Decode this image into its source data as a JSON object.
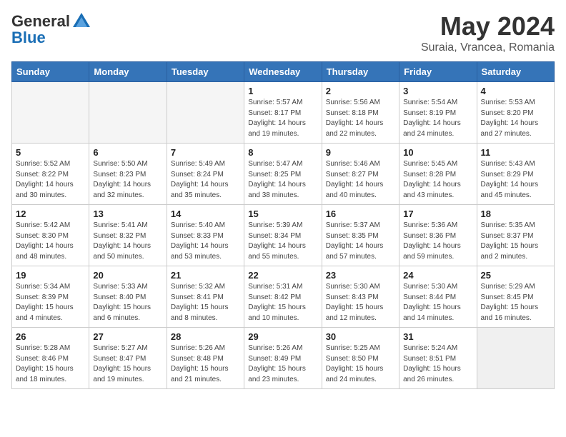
{
  "logo": {
    "general": "General",
    "blue": "Blue"
  },
  "title": "May 2024",
  "subtitle": "Suraia, Vrancea, Romania",
  "days_of_week": [
    "Sunday",
    "Monday",
    "Tuesday",
    "Wednesday",
    "Thursday",
    "Friday",
    "Saturday"
  ],
  "weeks": [
    [
      {
        "day": "",
        "info": "",
        "empty": true
      },
      {
        "day": "",
        "info": "",
        "empty": true
      },
      {
        "day": "",
        "info": "",
        "empty": true
      },
      {
        "day": "1",
        "info": "Sunrise: 5:57 AM\nSunset: 8:17 PM\nDaylight: 14 hours\nand 19 minutes."
      },
      {
        "day": "2",
        "info": "Sunrise: 5:56 AM\nSunset: 8:18 PM\nDaylight: 14 hours\nand 22 minutes."
      },
      {
        "day": "3",
        "info": "Sunrise: 5:54 AM\nSunset: 8:19 PM\nDaylight: 14 hours\nand 24 minutes."
      },
      {
        "day": "4",
        "info": "Sunrise: 5:53 AM\nSunset: 8:20 PM\nDaylight: 14 hours\nand 27 minutes."
      }
    ],
    [
      {
        "day": "5",
        "info": "Sunrise: 5:52 AM\nSunset: 8:22 PM\nDaylight: 14 hours\nand 30 minutes."
      },
      {
        "day": "6",
        "info": "Sunrise: 5:50 AM\nSunset: 8:23 PM\nDaylight: 14 hours\nand 32 minutes."
      },
      {
        "day": "7",
        "info": "Sunrise: 5:49 AM\nSunset: 8:24 PM\nDaylight: 14 hours\nand 35 minutes."
      },
      {
        "day": "8",
        "info": "Sunrise: 5:47 AM\nSunset: 8:25 PM\nDaylight: 14 hours\nand 38 minutes."
      },
      {
        "day": "9",
        "info": "Sunrise: 5:46 AM\nSunset: 8:27 PM\nDaylight: 14 hours\nand 40 minutes."
      },
      {
        "day": "10",
        "info": "Sunrise: 5:45 AM\nSunset: 8:28 PM\nDaylight: 14 hours\nand 43 minutes."
      },
      {
        "day": "11",
        "info": "Sunrise: 5:43 AM\nSunset: 8:29 PM\nDaylight: 14 hours\nand 45 minutes."
      }
    ],
    [
      {
        "day": "12",
        "info": "Sunrise: 5:42 AM\nSunset: 8:30 PM\nDaylight: 14 hours\nand 48 minutes."
      },
      {
        "day": "13",
        "info": "Sunrise: 5:41 AM\nSunset: 8:32 PM\nDaylight: 14 hours\nand 50 minutes."
      },
      {
        "day": "14",
        "info": "Sunrise: 5:40 AM\nSunset: 8:33 PM\nDaylight: 14 hours\nand 53 minutes."
      },
      {
        "day": "15",
        "info": "Sunrise: 5:39 AM\nSunset: 8:34 PM\nDaylight: 14 hours\nand 55 minutes."
      },
      {
        "day": "16",
        "info": "Sunrise: 5:37 AM\nSunset: 8:35 PM\nDaylight: 14 hours\nand 57 minutes."
      },
      {
        "day": "17",
        "info": "Sunrise: 5:36 AM\nSunset: 8:36 PM\nDaylight: 14 hours\nand 59 minutes."
      },
      {
        "day": "18",
        "info": "Sunrise: 5:35 AM\nSunset: 8:37 PM\nDaylight: 15 hours\nand 2 minutes."
      }
    ],
    [
      {
        "day": "19",
        "info": "Sunrise: 5:34 AM\nSunset: 8:39 PM\nDaylight: 15 hours\nand 4 minutes."
      },
      {
        "day": "20",
        "info": "Sunrise: 5:33 AM\nSunset: 8:40 PM\nDaylight: 15 hours\nand 6 minutes."
      },
      {
        "day": "21",
        "info": "Sunrise: 5:32 AM\nSunset: 8:41 PM\nDaylight: 15 hours\nand 8 minutes."
      },
      {
        "day": "22",
        "info": "Sunrise: 5:31 AM\nSunset: 8:42 PM\nDaylight: 15 hours\nand 10 minutes."
      },
      {
        "day": "23",
        "info": "Sunrise: 5:30 AM\nSunset: 8:43 PM\nDaylight: 15 hours\nand 12 minutes."
      },
      {
        "day": "24",
        "info": "Sunrise: 5:30 AM\nSunset: 8:44 PM\nDaylight: 15 hours\nand 14 minutes."
      },
      {
        "day": "25",
        "info": "Sunrise: 5:29 AM\nSunset: 8:45 PM\nDaylight: 15 hours\nand 16 minutes."
      }
    ],
    [
      {
        "day": "26",
        "info": "Sunrise: 5:28 AM\nSunset: 8:46 PM\nDaylight: 15 hours\nand 18 minutes."
      },
      {
        "day": "27",
        "info": "Sunrise: 5:27 AM\nSunset: 8:47 PM\nDaylight: 15 hours\nand 19 minutes."
      },
      {
        "day": "28",
        "info": "Sunrise: 5:26 AM\nSunset: 8:48 PM\nDaylight: 15 hours\nand 21 minutes."
      },
      {
        "day": "29",
        "info": "Sunrise: 5:26 AM\nSunset: 8:49 PM\nDaylight: 15 hours\nand 23 minutes."
      },
      {
        "day": "30",
        "info": "Sunrise: 5:25 AM\nSunset: 8:50 PM\nDaylight: 15 hours\nand 24 minutes."
      },
      {
        "day": "31",
        "info": "Sunrise: 5:24 AM\nSunset: 8:51 PM\nDaylight: 15 hours\nand 26 minutes."
      },
      {
        "day": "",
        "info": "",
        "empty": true
      }
    ]
  ]
}
